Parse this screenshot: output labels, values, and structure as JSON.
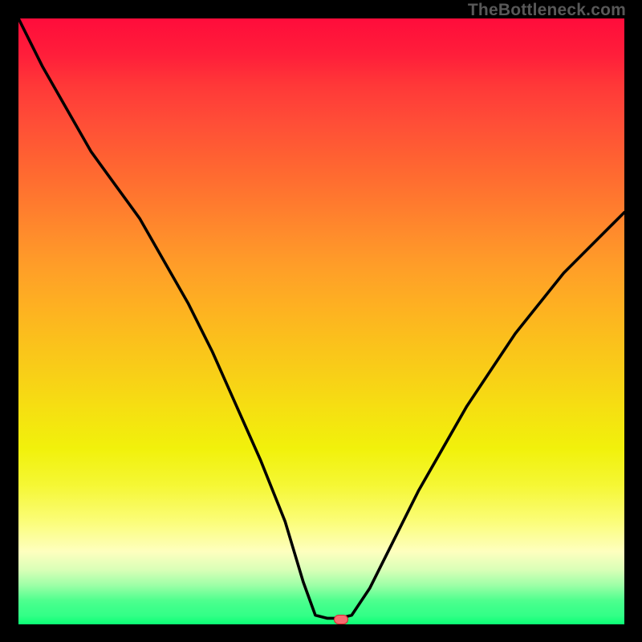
{
  "watermark": {
    "text": "TheBottleneck.com"
  },
  "colors": {
    "marker_fill": "#f86a6f",
    "marker_stroke": "#d72332",
    "curve_stroke": "#000000"
  },
  "chart_data": {
    "type": "line",
    "title": "",
    "xlabel": "",
    "ylabel": "",
    "xlim": [
      0,
      100
    ],
    "ylim": [
      0,
      100
    ],
    "series": [
      {
        "name": "bottleneck-curve",
        "x": [
          0,
          4,
          8,
          12,
          16,
          20,
          24,
          28,
          32,
          36,
          40,
          44,
          47,
          49,
          51,
          53,
          55,
          58,
          62,
          66,
          70,
          74,
          78,
          82,
          86,
          90,
          94,
          98,
          100
        ],
        "y": [
          100,
          92,
          85,
          78,
          72.5,
          67,
          60,
          53,
          45,
          36,
          27,
          17,
          7,
          1.5,
          1,
          1,
          1.5,
          6,
          14,
          22,
          29,
          36,
          42,
          48,
          53,
          58,
          62,
          66,
          68
        ]
      }
    ],
    "optimum_marker": {
      "x": 53.2,
      "y": 0.8
    },
    "gradient_stops": [
      {
        "pct": 0,
        "color": "#ff0c3b"
      },
      {
        "pct": 50,
        "color": "#fbbe1d"
      },
      {
        "pct": 77,
        "color": "#f5f734"
      },
      {
        "pct": 90,
        "color": "#feffc4"
      },
      {
        "pct": 100,
        "color": "#0bff75"
      }
    ]
  }
}
